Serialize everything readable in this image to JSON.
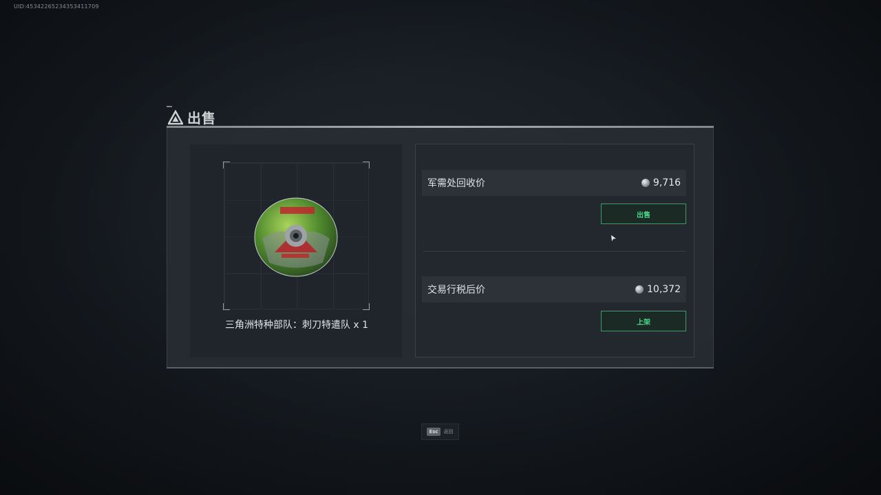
{
  "uid": "UID:45342265234353411709",
  "dialog": {
    "title": "出售",
    "title_icon": "triangle-logo-icon"
  },
  "item": {
    "name": "三角洲特种部队：刺刀特遣队 x 1",
    "icon": "game-disc-icon"
  },
  "prices": [
    {
      "label": "军需处回收价",
      "value": "9,716",
      "currency_icon": "coin-icon"
    },
    {
      "label": "交易行税后价",
      "value": "10,372",
      "currency_icon": "coin-icon"
    }
  ],
  "buttons": {
    "sell": "出售",
    "list": "上架"
  },
  "footer": {
    "key": "Esc",
    "label": "返回"
  },
  "colors": {
    "accent_green": "#48d688",
    "button_border": "#3e9c6a",
    "panel_bg": "#282d33"
  }
}
